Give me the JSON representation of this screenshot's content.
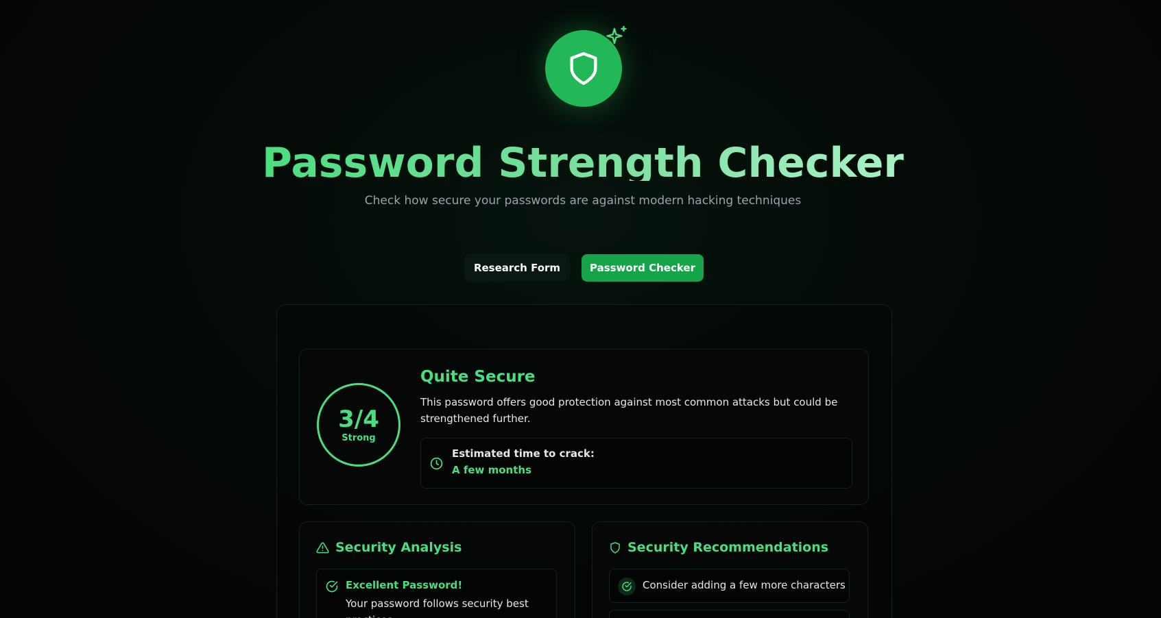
{
  "header": {
    "title": "Password Strength Checker",
    "subtitle": "Check how secure your passwords are against modern hacking techniques",
    "logo_icon": "shield-icon",
    "sparkle_icon": "sparkle-icon",
    "accent_color": "#22c55e"
  },
  "tabs": [
    {
      "label": "Research Form",
      "active": false
    },
    {
      "label": "Password Checker",
      "active": true
    }
  ],
  "result": {
    "score": "3/4",
    "score_label": "Strong",
    "strength_title": "Quite Secure",
    "description": "This password offers good protection against most common attacks but could be strengthened further.",
    "crack_label": "Estimated time to crack:",
    "crack_value": "A few months",
    "crack_icon": "clock-icon"
  },
  "analysis": {
    "title": "Security Analysis",
    "icon": "warning-triangle-icon",
    "items": [
      {
        "heading": "Excellent Password!",
        "text": "Your password follows security best practices.",
        "icon": "check-circle-icon"
      }
    ]
  },
  "recommendations": {
    "title": "Security Recommendations",
    "icon": "shield-icon",
    "items": [
      {
        "text": "Consider adding a few more characters",
        "icon": "check-circle-icon"
      }
    ]
  }
}
